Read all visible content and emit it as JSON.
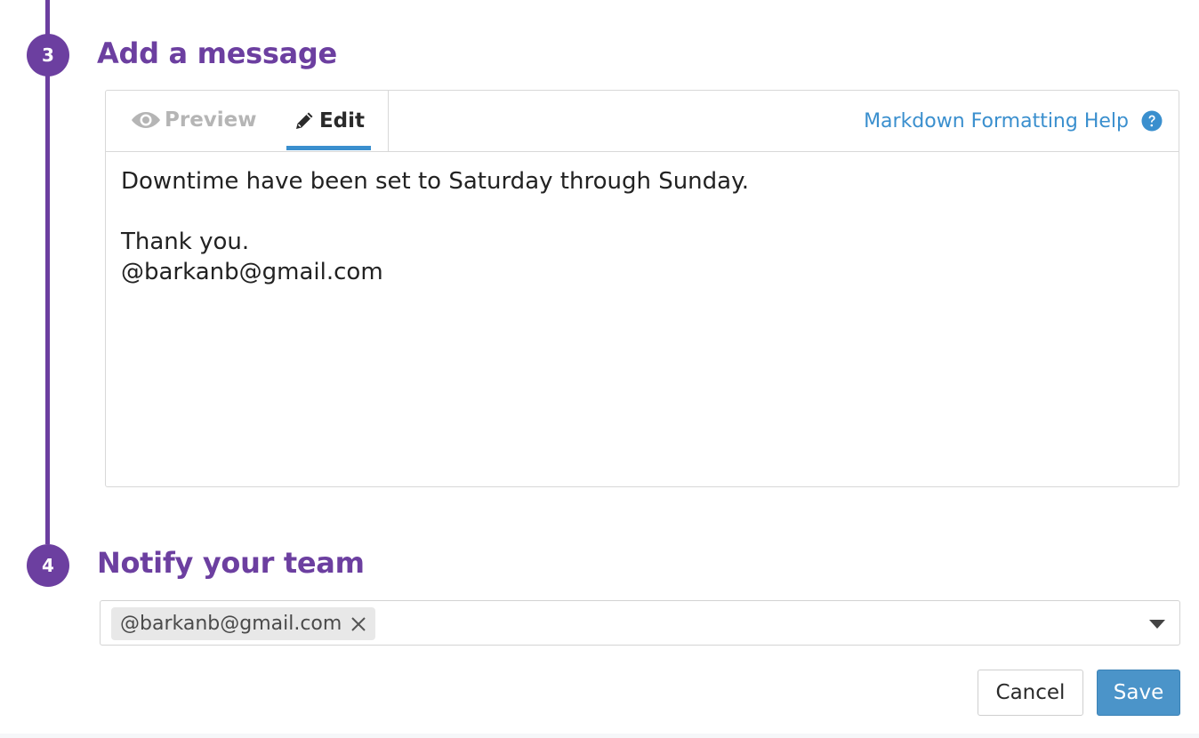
{
  "steps": {
    "message": {
      "number": "3",
      "title": "Add a message"
    },
    "notify": {
      "number": "4",
      "title": "Notify your team"
    }
  },
  "editor": {
    "tabs": {
      "preview_label": "Preview",
      "edit_label": "Edit",
      "active": "Edit"
    },
    "help_link_label": "Markdown Formatting Help",
    "body_text": "Downtime have been set to Saturday through Sunday.\n\nThank you.\n@barkanb@gmail.com"
  },
  "notify": {
    "selected_recipients": [
      "@barkanb@gmail.com"
    ]
  },
  "actions": {
    "cancel_label": "Cancel",
    "save_label": "Save"
  },
  "colors": {
    "accent_purple": "#6c3fa0",
    "link_blue": "#3a8fce",
    "save_blue": "#4b94c9"
  },
  "icons": {
    "preview_tab": "eye-icon",
    "edit_tab": "pencil-icon",
    "help": "question-circle-icon",
    "chip_remove": "close-icon",
    "dropdown": "chevron-down-icon"
  }
}
